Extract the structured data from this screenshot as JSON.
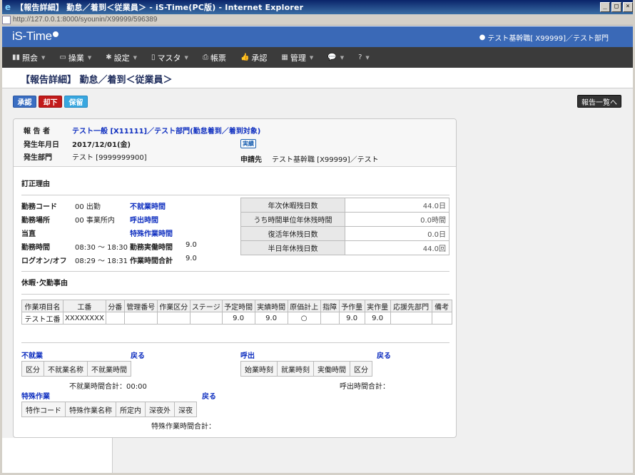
{
  "window": {
    "title": "【報告詳細】 勤怠／着到＜従業員＞ - iS-Time(PC版) - Internet Explorer",
    "url": "http://127.0.0.1:8000/syounin/X99999/596389",
    "btn_min": "_",
    "btn_max": "□",
    "btn_close": "×"
  },
  "header": {
    "logo": "iS-Time",
    "user": "テスト基幹職[ X99999]／テスト部門"
  },
  "menu": [
    {
      "label": "照会",
      "icon": "bar-chart-icon",
      "glyph": "▮▮",
      "caret": true
    },
    {
      "label": "操業",
      "icon": "monitor-icon",
      "glyph": "▭",
      "caret": true
    },
    {
      "label": "設定",
      "icon": "gear-icon",
      "glyph": "✱",
      "caret": true
    },
    {
      "label": "マスタ",
      "icon": "file-icon",
      "glyph": "▯",
      "caret": true
    },
    {
      "label": "帳票",
      "icon": "printer-icon",
      "glyph": "⎙",
      "caret": false
    },
    {
      "label": "承認",
      "icon": "thumbs-up-icon",
      "glyph": "👍",
      "caret": false
    },
    {
      "label": "管理",
      "icon": "table-icon",
      "glyph": "▦",
      "caret": true
    },
    {
      "label": "",
      "icon": "comments-icon",
      "glyph": "💬",
      "caret": true
    },
    {
      "label": "",
      "icon": "question-icon",
      "glyph": "?",
      "caret": true
    }
  ],
  "page": {
    "title": "【報告詳細】 勤怠／着到＜従業員＞"
  },
  "buttons": {
    "approve": "承認",
    "reject": "却下",
    "hold": "保留",
    "list": "報告一覧へ"
  },
  "report": {
    "reporter_label": "報 告 者",
    "reporter_value": "テスト一般 [X11111]／テスト部門(勤怠着到／着到対象)",
    "date_label": "発生年月日",
    "date_value": "2017/12/01(金)",
    "badge": "実績",
    "dept_label": "発生部門",
    "dept_value": "テスト [9999999900]",
    "applicant_label": "申請先",
    "applicant_value": "テスト基幹職 [X99999]／テスト"
  },
  "correction": {
    "title": "訂正理由"
  },
  "attendance": {
    "code_label": "勤務コード",
    "code_value": "00 出勤",
    "place_label": "勤務場所",
    "place_value": "00 事業所内",
    "duty_label": "当直",
    "hours_label": "勤務時間",
    "hours_value": "08:30 〜 18:30",
    "logon_label": "ログオン/オフ",
    "logon_value": "08:29 〜 18:31",
    "link_absence": "不就業時間",
    "link_callout": "呼出時間",
    "link_special": "特殊作業時間",
    "actual_label": "勤務実働時間",
    "actual_value": "9.0",
    "work_total_label": "作業時間合計",
    "work_total_value": "9.0"
  },
  "leave_balance": [
    {
      "label": "年次休暇残日数",
      "value": "44.0日"
    },
    {
      "label": "うち時間単位年休残時間",
      "value": "0.0時間"
    },
    {
      "label": "復活年休残日数",
      "value": "0.0日"
    },
    {
      "label": "半日年休残日数",
      "value": "44.0回"
    }
  ],
  "absence_reason": {
    "title": "休暇･欠勤事由"
  },
  "work_table": {
    "headers": [
      "作業項目名",
      "工番",
      "分番",
      "管理番号",
      "作業区分",
      "ステージ",
      "予定時間",
      "実績時間",
      "原価計上",
      "指障",
      "予作量",
      "実作量",
      "応援先部門",
      "備考"
    ],
    "rows": [
      [
        "テスト工番",
        "XXXXXXXX",
        "",
        "",
        "",
        "",
        "9.0",
        "9.0",
        "○",
        "",
        "9.0",
        "9.0",
        "",
        ""
      ]
    ]
  },
  "absence": {
    "title": "不就業",
    "back": "戻る",
    "headers": [
      "区分",
      "不就業名称",
      "不就業時間"
    ],
    "total": "不就業時間合計：00:00"
  },
  "callout": {
    "title": "呼出",
    "back": "戻る",
    "headers": [
      "始業時刻",
      "就業時刻",
      "実働時間",
      "区分"
    ],
    "total": "呼出時間合計："
  },
  "special": {
    "title": "特殊作業",
    "back": "戻る",
    "headers": [
      "特作コード",
      "特殊作業名称",
      "所定内",
      "深夜外",
      "深夜"
    ],
    "total": "特殊作業時間合計："
  }
}
